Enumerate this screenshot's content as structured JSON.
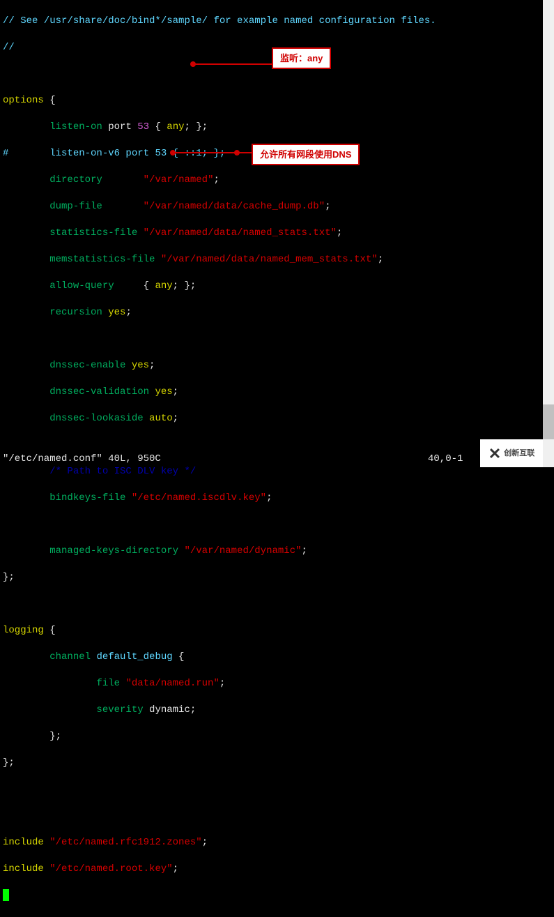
{
  "code": {
    "l1": "// See /usr/share/doc/bind*/sample/ for example named configuration files.",
    "l2": "//",
    "l3_kw": "options",
    "l3_brace": " {",
    "l4_kw": "listen-on",
    "l4_mid": " port ",
    "l4_num": "53",
    "l4_a": " { ",
    "l4_any": "any",
    "l4_b": "; };",
    "l5_hash": "#",
    "l5_rest": "       listen-on-v6 port 53 { ::1; };",
    "l6_kw": "directory",
    "l6_sp": "       ",
    "l6_str": "\"/var/named\"",
    "l6_sc": ";",
    "l7_kw": "dump-file",
    "l7_sp": "       ",
    "l7_str": "\"/var/named/data/cache_dump.db\"",
    "l7_sc": ";",
    "l8_kw": "statistics-file",
    "l8_sp": " ",
    "l8_str": "\"/var/named/data/named_stats.txt\"",
    "l8_sc": ";",
    "l9_kw": "memstatistics-file",
    "l9_sp": " ",
    "l9_str": "\"/var/named/data/named_mem_stats.txt\"",
    "l9_sc": ";",
    "l10_kw": "allow-query",
    "l10_sp": "     { ",
    "l10_any": "any",
    "l10_b": "; };",
    "l11_kw": "recursion",
    "l11_sp": " ",
    "l11_val": "yes",
    "l11_sc": ";",
    "l12_kw": "dnssec-enable",
    "l12_val": " yes",
    "l12_sc": ";",
    "l13_kw": "dnssec-validation",
    "l13_val": " yes",
    "l13_sc": ";",
    "l14_kw": "dnssec-lookaside",
    "l14_val": " auto",
    "l14_sc": ";",
    "l15_cmt": "/* Path to ISC DLV key */",
    "l16_kw": "bindkeys-file",
    "l16_sp": " ",
    "l16_str": "\"/etc/named.iscdlv.key\"",
    "l16_sc": ";",
    "l17_kw": "managed-keys-directory",
    "l17_sp": " ",
    "l17_str": "\"/var/named/dynamic\"",
    "l17_sc": ";",
    "l18_brace": "};",
    "l19_kw": "logging",
    "l19_brace": " {",
    "l20_kw": "channel",
    "l20_sp": " ",
    "l20_name": "default_debug",
    "l20_b": " {",
    "l21_kw": "file",
    "l21_sp": " ",
    "l21_str": "\"data/named.run\"",
    "l21_sc": ";",
    "l22_kw": "severity",
    "l22_val": " dynamic;",
    "l23_brace": "        };",
    "l24_brace": "};",
    "l25_kw": "include",
    "l25_sp": " ",
    "l25_str": "\"/etc/named.rfc1912.zones\"",
    "l25_sc": ";",
    "l26_kw": "include",
    "l26_sp": " ",
    "l26_str": "\"/etc/named.root.key\"",
    "l26_sc": ";"
  },
  "annotations": {
    "listen": "监听：any",
    "allow": "允许所有网段使用DNS"
  },
  "status": {
    "file": "\"/etc/named.conf\" 40L, 950C",
    "pos": "40,0-1"
  },
  "watermark": {
    "text": "创新互联"
  }
}
